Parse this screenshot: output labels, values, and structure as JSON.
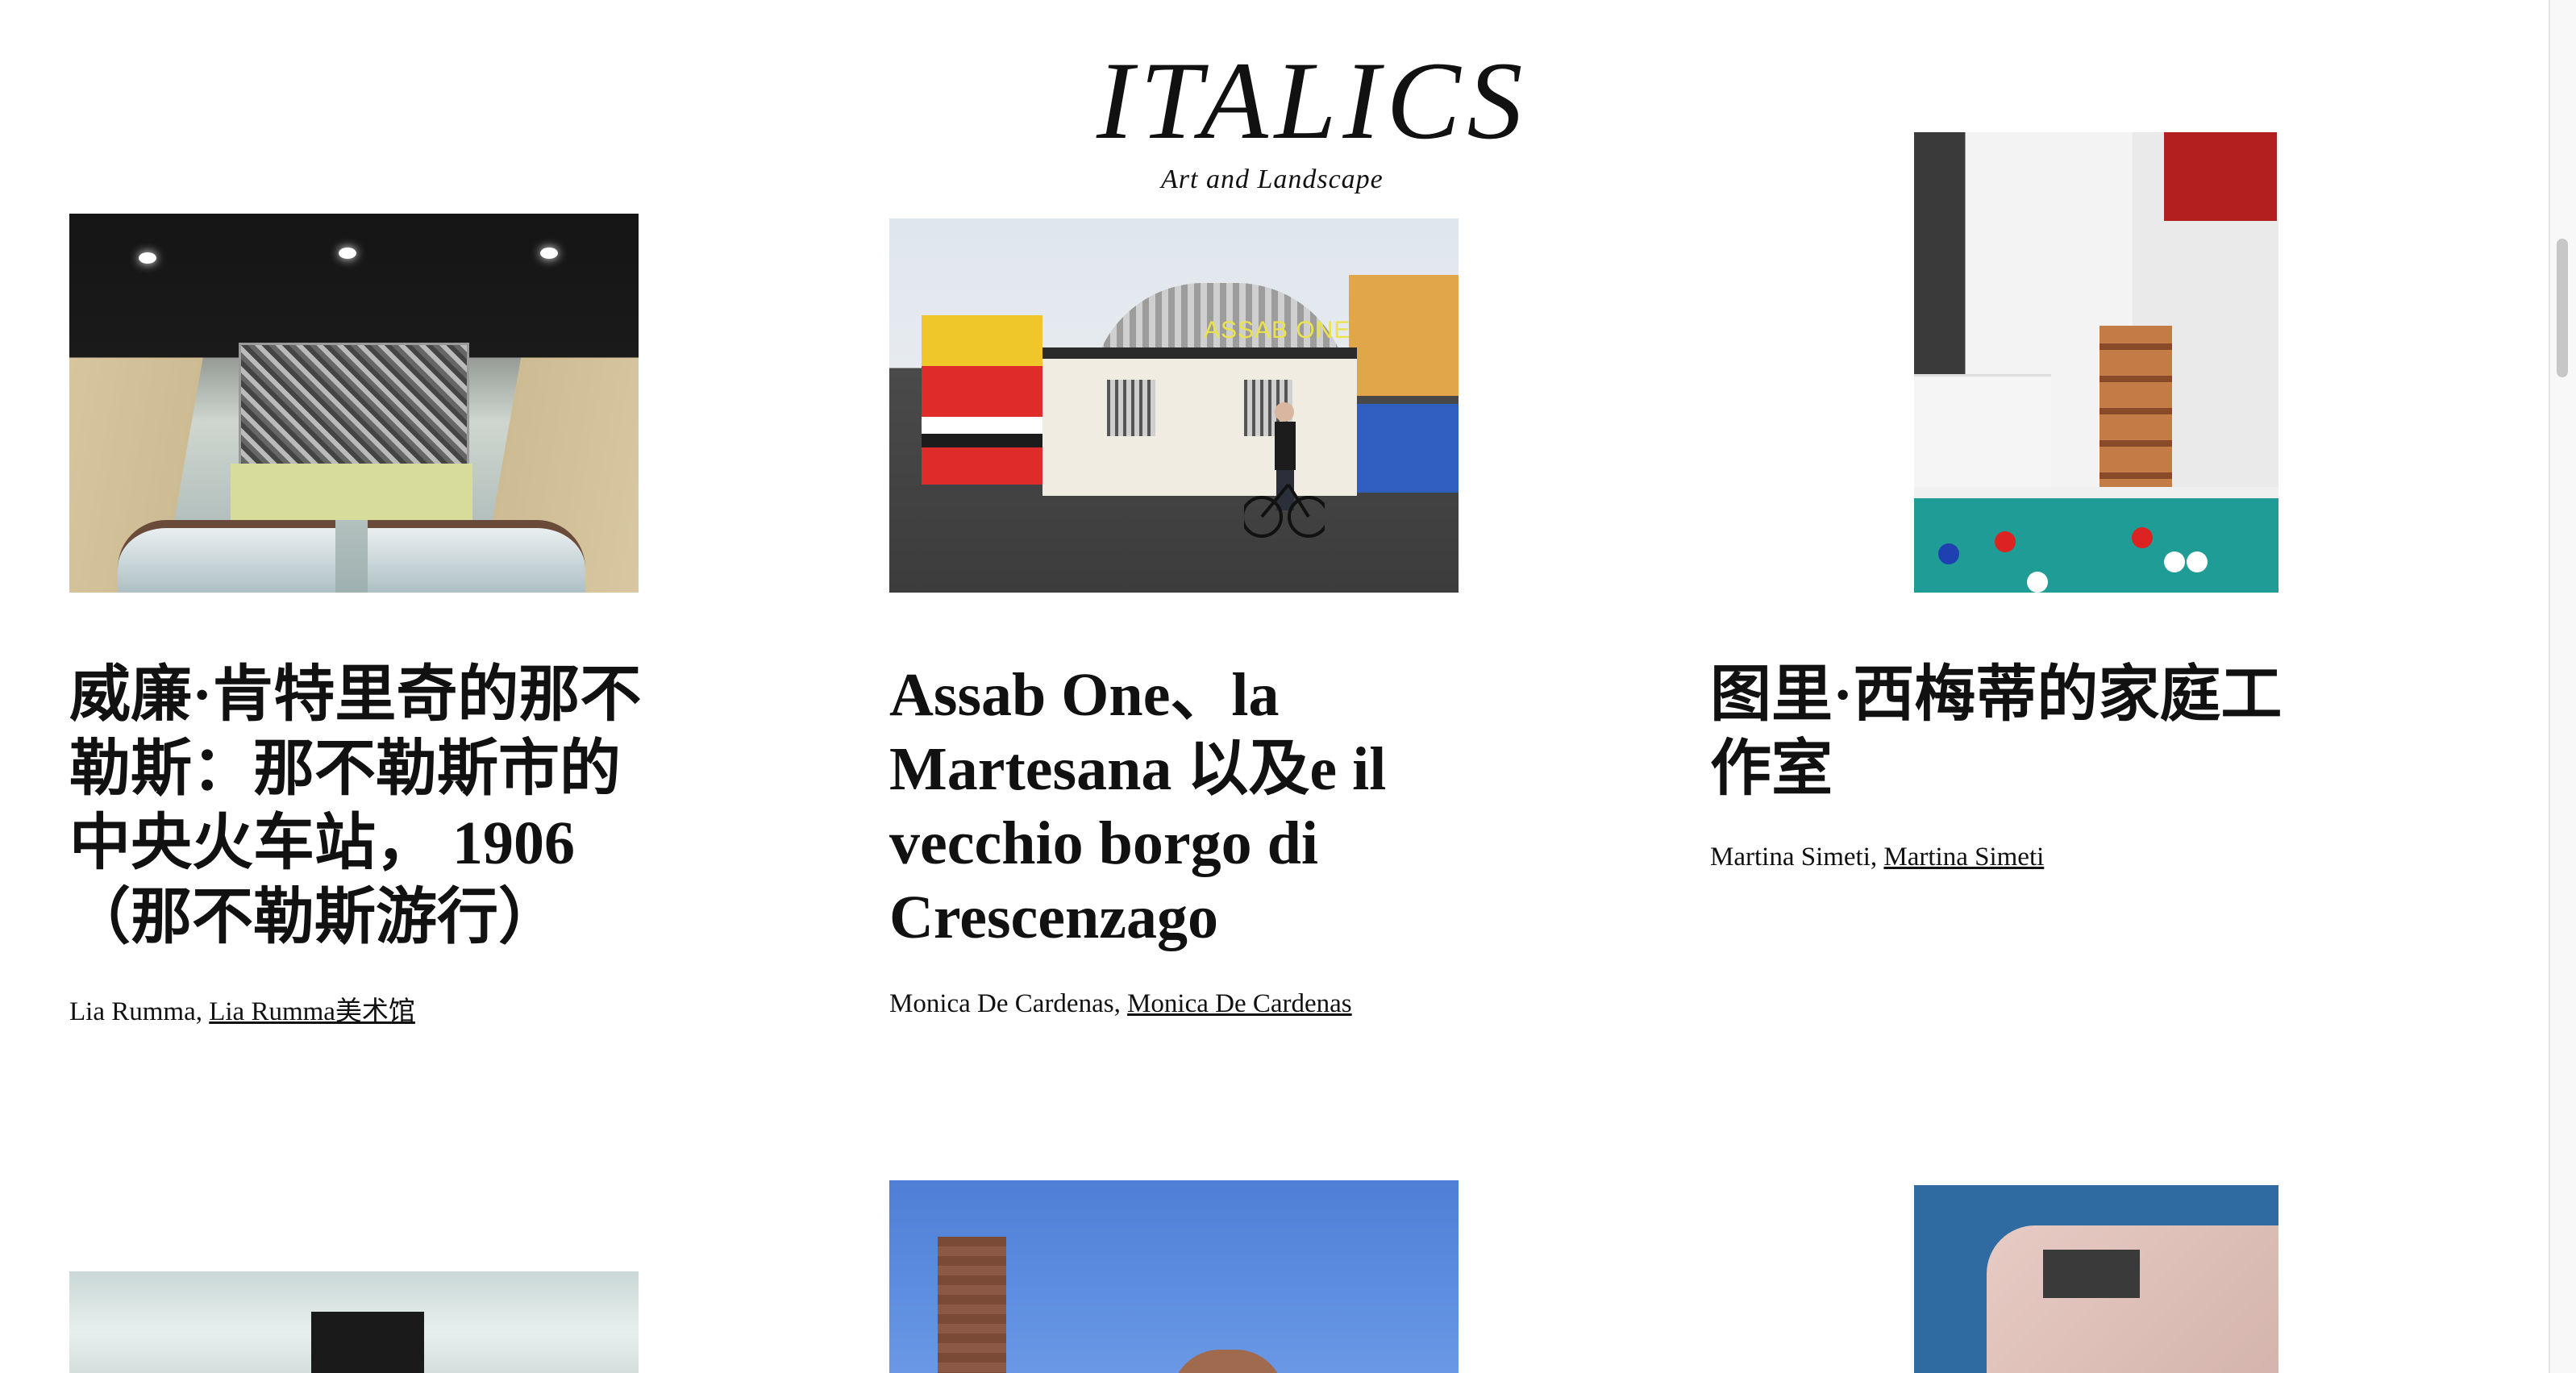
{
  "brand": {
    "title": "ITALICS",
    "subtitle": "Art and Landscape"
  },
  "cards": [
    {
      "title": "威廉·肯特里奇的那不勒斯：那不勒斯市的中央火车站， 1906（那不勒斯游行）",
      "artist": "Lia Rumma,",
      "venue_link": "Lia Rumma美术馆",
      "image": "metro-station-escalator-mural"
    },
    {
      "title": "Assab One、la Martesana 以及e il vecchio borgo di Crescenzago",
      "artist": "Monica De Cardenas,",
      "venue_link": "Monica De Cardenas",
      "image": "assab-one-building-cyclist"
    },
    {
      "title": "图里·西梅蒂的家庭工作室",
      "artist": "Martina Simeti,",
      "venue_link": "Martina Simeti",
      "image": "home-studio-pool-table"
    }
  ],
  "assab_sign": "ASSAB ONE"
}
